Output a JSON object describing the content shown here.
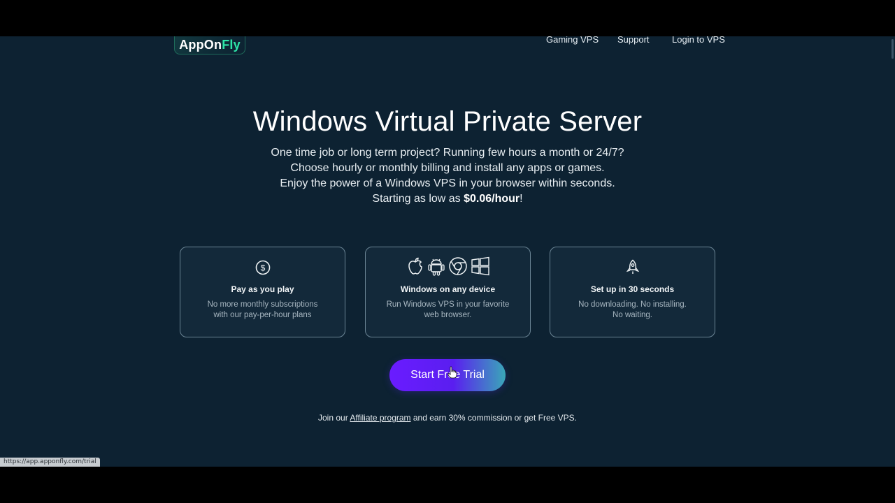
{
  "header": {
    "logo": {
      "text_main": "AppOn",
      "text_accent": "Fly",
      "accent_color": "#2ee6a8"
    },
    "nav": [
      {
        "label": "Gaming VPS"
      },
      {
        "label": "Support"
      },
      {
        "label": "Login to VPS"
      }
    ]
  },
  "hero": {
    "title": "Windows Virtual Private Server",
    "lines": [
      "One time job or long term project? Running few hours a month or 24/7?",
      "Choose hourly or monthly billing and install any apps or games.",
      "Enjoy the power of a Windows VPS in your browser within seconds."
    ],
    "price_prefix": "Starting as low as ",
    "price": "$0.06/hour",
    "price_suffix": "!"
  },
  "features": [
    {
      "icon": "dollar-circle-icon",
      "title": "Pay as you play",
      "desc_line1": "No more monthly subscriptions",
      "desc_line2": "with our pay-per-hour plans"
    },
    {
      "icons": [
        "apple-icon",
        "android-icon",
        "chrome-icon",
        "windows-icon"
      ],
      "title": "Windows on any device",
      "desc_line1": "Run Windows VPS in your favorite",
      "desc_line2": "web browser."
    },
    {
      "icon": "rocket-icon",
      "title": "Set up in 30 seconds",
      "desc_line1": "No downloading. No installing.",
      "desc_line2": "No waiting."
    }
  ],
  "cta": {
    "label": "Start Free Trial"
  },
  "affiliate": {
    "prefix": "Join our ",
    "link": "Affiliate program",
    "suffix": " and earn 30% commission or get Free VPS."
  },
  "status_bar": {
    "url": "https://app.apponfly.com/trial"
  },
  "colors": {
    "background": "#0d2232",
    "card_border": "#6b8595",
    "cta_start": "#6a1cff",
    "cta_end": "#3aa7b8"
  }
}
